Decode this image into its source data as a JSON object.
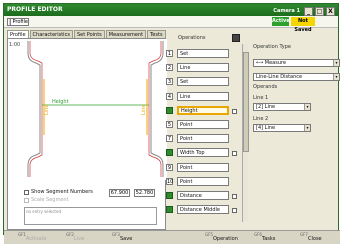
{
  "window": {
    "title": "PROFILE EDITOR",
    "status_text": "Camera 1",
    "min_label": "_",
    "max_label": "□",
    "close_label": "X"
  },
  "toolbar": {
    "profile_label": "Profile",
    "active_label": "Active",
    "not_saved_label": "Not Saved"
  },
  "tabs": [
    "Profile",
    "Characteristics",
    "Set Points",
    "Measurement",
    "Tests"
  ],
  "graph": {
    "vscale_label": "1:00",
    "height_label": "Height",
    "line_left_label": "Line",
    "line_right_label": "Line",
    "accent_color": "#2da02d",
    "highlight_color": "#e9a800",
    "trace_color": "#cc3333"
  },
  "left": {
    "show_numbers_label": "Show Segment Numbers",
    "scale_label": "Scale Segment",
    "num_left": "67.900",
    "num_right": "52.780",
    "message": "no entry selected"
  },
  "operations": {
    "title": "Operations",
    "items": [
      {
        "num": "1",
        "label": "Set",
        "selected": false,
        "green": false,
        "check": false
      },
      {
        "num": "2",
        "label": "Line",
        "selected": false,
        "green": false,
        "check": false
      },
      {
        "num": "3",
        "label": "Set",
        "selected": false,
        "green": false,
        "check": false
      },
      {
        "num": "4",
        "label": "Line",
        "selected": false,
        "green": false,
        "check": false
      },
      {
        "num": "",
        "label": "Height",
        "selected": true,
        "green": true,
        "check": true
      },
      {
        "num": "5",
        "label": "Point",
        "selected": false,
        "green": false,
        "check": false
      },
      {
        "num": "7",
        "label": "Point",
        "selected": false,
        "green": false,
        "check": false
      },
      {
        "num": "",
        "label": "Width Top",
        "selected": false,
        "green": true,
        "check": true
      },
      {
        "num": "9",
        "label": "Point",
        "selected": false,
        "green": false,
        "check": false
      },
      {
        "num": "10",
        "label": "Point",
        "selected": false,
        "green": false,
        "check": false
      },
      {
        "num": "",
        "label": "Distance",
        "selected": false,
        "green": true,
        "check": true
      },
      {
        "num": "",
        "label": "Distance Middle",
        "selected": false,
        "green": true,
        "check": true
      }
    ]
  },
  "operation_type": {
    "title": "Operation Type",
    "type_value": "Measure",
    "subtype_value": "Line-Line Distance",
    "operands_label": "Operands",
    "line1_label": "Line 1",
    "line1_value": "[2] Line",
    "line2_label": "Line 2",
    "line2_value": "[4] Line"
  },
  "fkeys": [
    {
      "fn": "GF1",
      "label": "Activate",
      "disabled": true
    },
    {
      "fn": "GF2",
      "label": "Live",
      "disabled": true
    },
    {
      "fn": "GF3",
      "label": "Save",
      "disabled": false
    },
    {
      "fn": "GF5",
      "label": "Operation",
      "disabled": false
    },
    {
      "fn": "GF6",
      "label": "Tasks",
      "disabled": false
    },
    {
      "fn": "GF7",
      "label": "Close",
      "disabled": false
    }
  ]
}
